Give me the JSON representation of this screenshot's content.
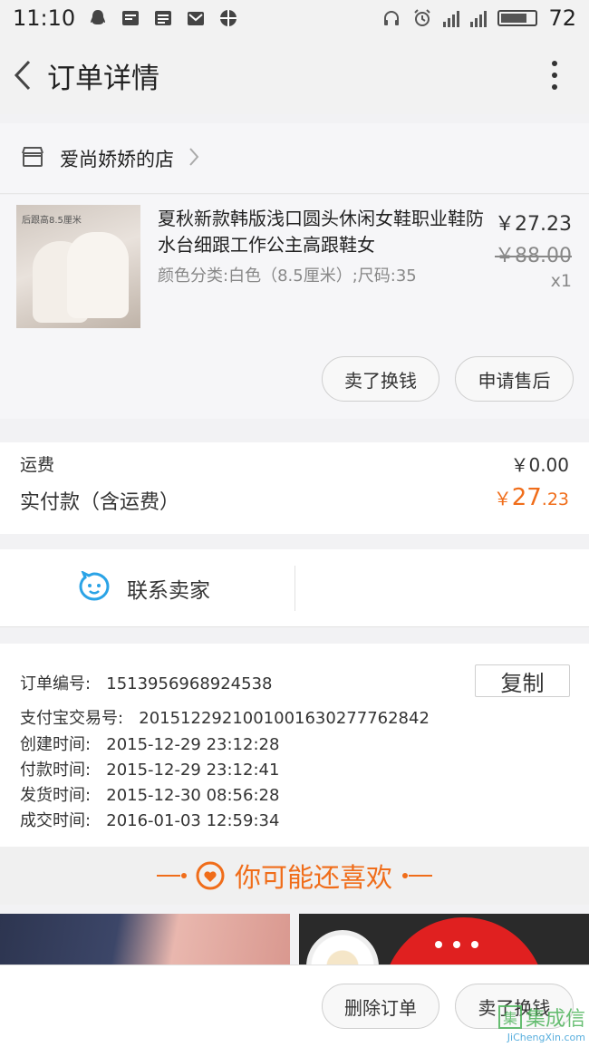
{
  "status_bar": {
    "time": "11:10",
    "battery": "72",
    "network": "4G"
  },
  "header": {
    "title": "订单详情"
  },
  "shop": {
    "name": "爱尚娇娇的店"
  },
  "product": {
    "title": "夏秋新款韩版浅口圆头休闲女鞋职业鞋防水台细跟工作公主高跟鞋女",
    "spec": "颜色分类:白色（8.5厘米）;尺码:35",
    "price": "￥27.23",
    "original_price": "￥88.00",
    "quantity": "x1",
    "image_caption": "后跟高8.5厘米",
    "actions": [
      "卖了换钱",
      "申请售后"
    ]
  },
  "summary": {
    "shipping_label": "运费",
    "shipping_value": "￥0.00",
    "paid_label": "实付款（含运费）",
    "paid_currency": "￥",
    "paid_integer": "27",
    "paid_decimal": ".23",
    "accent_color": "#f06d1a"
  },
  "contact": {
    "label": "联系卖家"
  },
  "order_info": {
    "order_no_label": "订单编号:",
    "order_no": "1513956968924538",
    "copy_label": "复制",
    "alipay_label": "支付宝交易号:",
    "alipay_no": "2015122921001001630277762842",
    "created_label": "创建时间:",
    "created": "2015-12-29 23:12:28",
    "paid_label": "付款时间:",
    "paid": "2015-12-29 23:12:41",
    "shipped_label": "发货时间:",
    "shipped": "2015-12-30 08:56:28",
    "completed_label": "成交时间:",
    "completed": "2016-01-03 12:59:34"
  },
  "recommend": {
    "title": "你可能还喜欢"
  },
  "bottom_bar": {
    "delete_label": "删除订单",
    "sell_label": "卖了换钱"
  },
  "watermark": {
    "cn": "集成信",
    "en": "JiChengXin.com"
  }
}
